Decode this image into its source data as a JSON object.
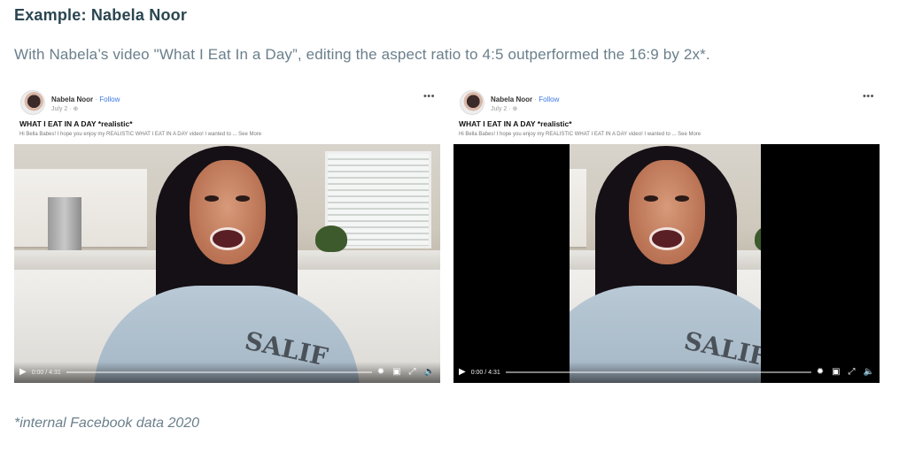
{
  "heading": "Example: Nabela Noor",
  "subtitle": "With Nabela’s video \"What I Eat In a Day”, editing the aspect ratio to 4:5 outperformed the 16:9 by 2x*.",
  "footnote": "*internal Facebook data 2020",
  "posts": [
    {
      "author": "Nabela Noor",
      "separator": "·",
      "follow": "Follow",
      "date": "July 2 · ⊕",
      "title": "WHAT I EAT IN A DAY *realistic*",
      "description": "Hi Bella Babes! I hope you enjoy my REALISTIC WHAT I EAT IN A DAY video! I wanted to ... See More",
      "more_icon": "•••",
      "time": "0:00 / 4:31",
      "progress": 0.0,
      "sweater_text": "SALIF"
    },
    {
      "author": "Nabela Noor",
      "separator": "·",
      "follow": "Follow",
      "date": "July 2 · ⊕",
      "title": "WHAT I EAT IN A DAY *realistic*",
      "description": "Hi Bella Babes! I hope you enjoy my REALISTIC WHAT I EAT IN A DAY video! I wanted to ... See More",
      "more_icon": "•••",
      "time": "0:00 / 4:31",
      "progress": 0.0,
      "sweater_text": "SALIF"
    }
  ],
  "icons": {
    "play": "▶",
    "settings": "✹",
    "pip": "▣",
    "fullscreen": "⤢",
    "volume": "🔈"
  }
}
